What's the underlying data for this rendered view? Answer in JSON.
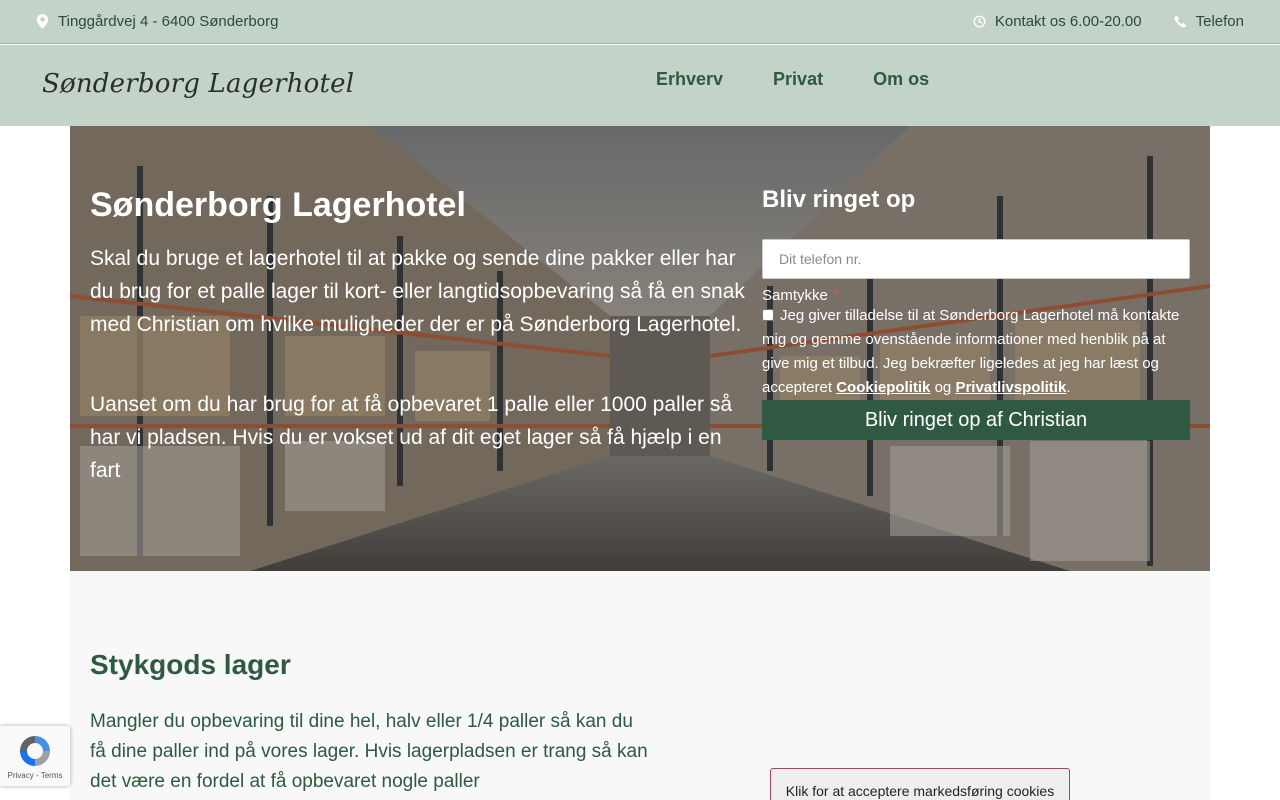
{
  "topbar": {
    "address": "Tinggårdvej 4 - 6400 Sønderborg",
    "contact": "Kontakt os 6.00-20.00",
    "phone": "Telefon"
  },
  "header": {
    "logo": "Sønderborg Lagerhotel",
    "nav": [
      "Erhverv",
      "Privat",
      "Om os"
    ]
  },
  "hero": {
    "title": "Sønderborg Lagerhotel",
    "paragraph1": "Skal du bruge et lagerhotel til at pakke og sende dine pakker eller har du brug for et palle lager til kort- eller langtidsopbevaring så få en snak med Christian om hvilke muligheder der er på Sønderborg Lagerhotel.",
    "paragraph2": "Uanset om du har brug for at få opbevaret 1 palle eller 1000 paller så har vi pladsen. Hvis du er vokset ud af dit eget lager så få hjælp i en fart"
  },
  "form": {
    "title": "Bliv ringet op",
    "phone_placeholder": "Dit telefon nr.",
    "consent_label": "Samtykke",
    "required_mark": "*",
    "consent_text_1": "Jeg giver tilladelse til at Sønderborg Lagerhotel må kontakte mig og gemme ovenstående informationer med henblik på at give mig et tilbud. Jeg bekræfter ligeledes at jeg har læst og accepteret",
    "cookie_link": "Cookiepolitik",
    "consent_and": "og",
    "privacy_link": "Privatlivspolitik",
    "period": ".",
    "submit": "Bliv ringet op af Christian"
  },
  "section": {
    "title": "Stykgods lager",
    "text": "Mangler du opbevaring til dine hel, halv eller 1/4 paller så kan du få dine paller ind på vores lager. Hvis lagerpladsen er trang så kan det være en fordel at få opbevaret nogle paller"
  },
  "cookie_button": "Klik for at acceptere markedsføring cookies",
  "recaptcha": {
    "privacy": "Privacy",
    "separator": "-",
    "terms": "Terms"
  },
  "colors": {
    "header_bg": "#c3d3c7",
    "brand_green": "#2f5a41",
    "white": "#ffffff"
  },
  "icons": [
    "map-pin-icon",
    "clock-icon",
    "phone-icon",
    "recaptcha-logo-icon"
  ]
}
